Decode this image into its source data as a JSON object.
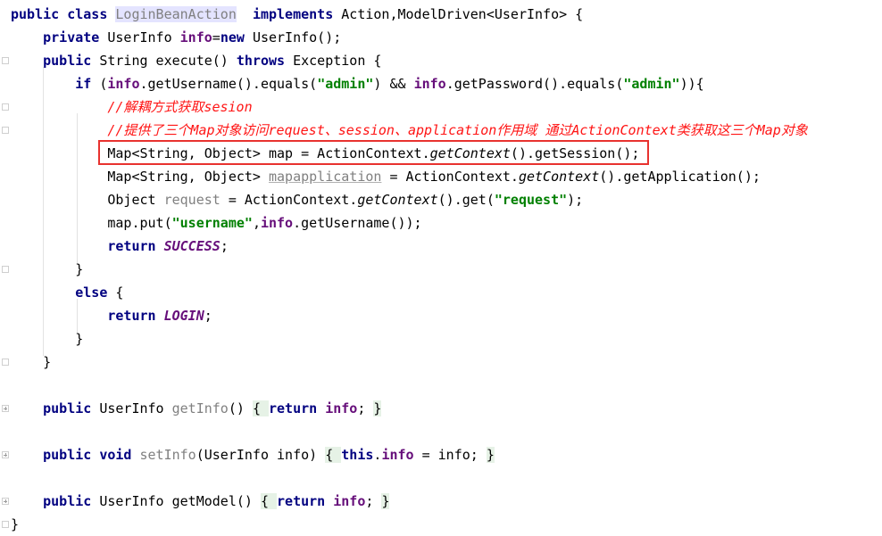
{
  "editor": {
    "lines": [
      {
        "tokens": [
          [
            "kw",
            "public class "
          ],
          [
            "hl-class",
            "LoginBeanAction"
          ],
          [
            "",
            "  "
          ],
          [
            "kw",
            "implements "
          ],
          [
            "",
            "Action,ModelDriven<UserInfo> {"
          ]
        ]
      },
      {
        "tokens": [
          [
            "",
            "    "
          ],
          [
            "kw",
            "private "
          ],
          [
            "",
            "UserInfo "
          ],
          [
            "fld",
            "info"
          ],
          [
            "",
            "="
          ],
          [
            "kw",
            "new "
          ],
          [
            "",
            "UserInfo();"
          ]
        ]
      },
      {
        "tokens": [
          [
            "",
            "    "
          ],
          [
            "kw",
            "public "
          ],
          [
            "",
            "String execute() "
          ],
          [
            "kw",
            "throws "
          ],
          [
            "",
            "Exception {"
          ]
        ]
      },
      {
        "tokens": [
          [
            "",
            "        "
          ],
          [
            "kw",
            "if "
          ],
          [
            "",
            "("
          ],
          [
            "fld",
            "info"
          ],
          [
            "",
            ".getUsername().equals("
          ],
          [
            "str",
            "\"admin\""
          ],
          [
            "",
            ") && "
          ],
          [
            "fld",
            "info"
          ],
          [
            "",
            ".getPassword().equals("
          ],
          [
            "str",
            "\"admin\""
          ],
          [
            "",
            ")){"
          ]
        ]
      },
      {
        "tokens": [
          [
            "",
            "            "
          ],
          [
            "cmt",
            "//解耦方式获取sesion"
          ]
        ]
      },
      {
        "tokens": [
          [
            "",
            "            "
          ],
          [
            "cmt",
            "//提供了三个Map对象访问request、session、application作用域 通过ActionContext类获取这三个Map对象"
          ]
        ]
      },
      {
        "tokens": [
          [
            "",
            "            Map<String, Object> map = ActionContext."
          ],
          [
            "ital",
            "getContext"
          ],
          [
            "",
            "().getSession();"
          ]
        ]
      },
      {
        "tokens": [
          [
            "",
            "            Map<String, Object> "
          ],
          [
            "unused under",
            "mapapplication"
          ],
          [
            "",
            " = ActionContext."
          ],
          [
            "ital",
            "getContext"
          ],
          [
            "",
            "().getApplication();"
          ]
        ]
      },
      {
        "tokens": [
          [
            "",
            "            Object "
          ],
          [
            "unused",
            "request"
          ],
          [
            "",
            " = ActionContext."
          ],
          [
            "ital",
            "getContext"
          ],
          [
            "",
            "().get("
          ],
          [
            "str",
            "\"request\""
          ],
          [
            "",
            ");"
          ]
        ]
      },
      {
        "tokens": [
          [
            "",
            "            map.put("
          ],
          [
            "str",
            "\"username\""
          ],
          [
            "",
            ","
          ],
          [
            "fld",
            "info"
          ],
          [
            "",
            ".getUsername());"
          ]
        ]
      },
      {
        "tokens": [
          [
            "",
            "            "
          ],
          [
            "kw",
            "return "
          ],
          [
            "cst",
            "SUCCESS"
          ],
          [
            "",
            ";"
          ]
        ]
      },
      {
        "tokens": [
          [
            "",
            "        }"
          ]
        ]
      },
      {
        "tokens": [
          [
            "",
            "        "
          ],
          [
            "kw",
            "else "
          ],
          [
            "",
            "{"
          ]
        ]
      },
      {
        "tokens": [
          [
            "",
            "            "
          ],
          [
            "kw",
            "return "
          ],
          [
            "cst",
            "LOGIN"
          ],
          [
            "",
            ";"
          ]
        ]
      },
      {
        "tokens": [
          [
            "",
            "        }"
          ]
        ]
      },
      {
        "tokens": [
          [
            "",
            "    }"
          ]
        ]
      },
      {
        "tokens": []
      },
      {
        "tokens": [
          [
            "",
            "    "
          ],
          [
            "kw",
            "public "
          ],
          [
            "",
            "UserInfo "
          ],
          [
            "unused",
            "getInfo"
          ],
          [
            "",
            "() "
          ],
          [
            "fold-brace",
            "{ "
          ],
          [
            "kw",
            "return "
          ],
          [
            "fld",
            "info"
          ],
          [
            "",
            "; "
          ],
          [
            "fold-brace",
            "}"
          ]
        ]
      },
      {
        "tokens": []
      },
      {
        "tokens": [
          [
            "",
            "    "
          ],
          [
            "kw",
            "public void "
          ],
          [
            "unused",
            "setInfo"
          ],
          [
            "",
            "(UserInfo info) "
          ],
          [
            "fold-brace",
            "{ "
          ],
          [
            "kw",
            "this"
          ],
          [
            "",
            "."
          ],
          [
            "fld",
            "info"
          ],
          [
            "",
            " = info; "
          ],
          [
            "fold-brace",
            "}"
          ]
        ]
      },
      {
        "tokens": []
      },
      {
        "tokens": [
          [
            "",
            "    "
          ],
          [
            "kw",
            "public "
          ],
          [
            "",
            "UserInfo getModel() "
          ],
          [
            "fold-brace",
            "{ "
          ],
          [
            "kw",
            "return "
          ],
          [
            "fld",
            "info"
          ],
          [
            "",
            "; "
          ],
          [
            "fold-brace",
            "}"
          ]
        ]
      },
      {
        "tokens": [
          [
            "",
            "}"
          ]
        ]
      }
    ]
  },
  "colors": {
    "keyword": "#000080",
    "field": "#660e7a",
    "string": "#008000",
    "comment": "#ff1414",
    "highlight_box": "#e8322f",
    "current_line": "#fffde6"
  },
  "icons": [
    "fold-marker-icon",
    "unfold-plus-icon"
  ]
}
